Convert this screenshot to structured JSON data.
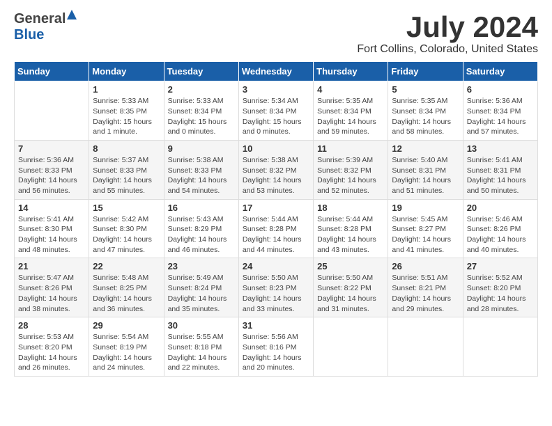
{
  "logo": {
    "general": "General",
    "blue": "Blue"
  },
  "title": {
    "month": "July 2024",
    "location": "Fort Collins, Colorado, United States"
  },
  "days_of_week": [
    "Sunday",
    "Monday",
    "Tuesday",
    "Wednesday",
    "Thursday",
    "Friday",
    "Saturday"
  ],
  "weeks": [
    [
      {
        "num": "",
        "info": ""
      },
      {
        "num": "1",
        "info": "Sunrise: 5:33 AM\nSunset: 8:35 PM\nDaylight: 15 hours\nand 1 minute."
      },
      {
        "num": "2",
        "info": "Sunrise: 5:33 AM\nSunset: 8:34 PM\nDaylight: 15 hours\nand 0 minutes."
      },
      {
        "num": "3",
        "info": "Sunrise: 5:34 AM\nSunset: 8:34 PM\nDaylight: 15 hours\nand 0 minutes."
      },
      {
        "num": "4",
        "info": "Sunrise: 5:35 AM\nSunset: 8:34 PM\nDaylight: 14 hours\nand 59 minutes."
      },
      {
        "num": "5",
        "info": "Sunrise: 5:35 AM\nSunset: 8:34 PM\nDaylight: 14 hours\nand 58 minutes."
      },
      {
        "num": "6",
        "info": "Sunrise: 5:36 AM\nSunset: 8:34 PM\nDaylight: 14 hours\nand 57 minutes."
      }
    ],
    [
      {
        "num": "7",
        "info": "Sunrise: 5:36 AM\nSunset: 8:33 PM\nDaylight: 14 hours\nand 56 minutes."
      },
      {
        "num": "8",
        "info": "Sunrise: 5:37 AM\nSunset: 8:33 PM\nDaylight: 14 hours\nand 55 minutes."
      },
      {
        "num": "9",
        "info": "Sunrise: 5:38 AM\nSunset: 8:33 PM\nDaylight: 14 hours\nand 54 minutes."
      },
      {
        "num": "10",
        "info": "Sunrise: 5:38 AM\nSunset: 8:32 PM\nDaylight: 14 hours\nand 53 minutes."
      },
      {
        "num": "11",
        "info": "Sunrise: 5:39 AM\nSunset: 8:32 PM\nDaylight: 14 hours\nand 52 minutes."
      },
      {
        "num": "12",
        "info": "Sunrise: 5:40 AM\nSunset: 8:31 PM\nDaylight: 14 hours\nand 51 minutes."
      },
      {
        "num": "13",
        "info": "Sunrise: 5:41 AM\nSunset: 8:31 PM\nDaylight: 14 hours\nand 50 minutes."
      }
    ],
    [
      {
        "num": "14",
        "info": "Sunrise: 5:41 AM\nSunset: 8:30 PM\nDaylight: 14 hours\nand 48 minutes."
      },
      {
        "num": "15",
        "info": "Sunrise: 5:42 AM\nSunset: 8:30 PM\nDaylight: 14 hours\nand 47 minutes."
      },
      {
        "num": "16",
        "info": "Sunrise: 5:43 AM\nSunset: 8:29 PM\nDaylight: 14 hours\nand 46 minutes."
      },
      {
        "num": "17",
        "info": "Sunrise: 5:44 AM\nSunset: 8:28 PM\nDaylight: 14 hours\nand 44 minutes."
      },
      {
        "num": "18",
        "info": "Sunrise: 5:44 AM\nSunset: 8:28 PM\nDaylight: 14 hours\nand 43 minutes."
      },
      {
        "num": "19",
        "info": "Sunrise: 5:45 AM\nSunset: 8:27 PM\nDaylight: 14 hours\nand 41 minutes."
      },
      {
        "num": "20",
        "info": "Sunrise: 5:46 AM\nSunset: 8:26 PM\nDaylight: 14 hours\nand 40 minutes."
      }
    ],
    [
      {
        "num": "21",
        "info": "Sunrise: 5:47 AM\nSunset: 8:26 PM\nDaylight: 14 hours\nand 38 minutes."
      },
      {
        "num": "22",
        "info": "Sunrise: 5:48 AM\nSunset: 8:25 PM\nDaylight: 14 hours\nand 36 minutes."
      },
      {
        "num": "23",
        "info": "Sunrise: 5:49 AM\nSunset: 8:24 PM\nDaylight: 14 hours\nand 35 minutes."
      },
      {
        "num": "24",
        "info": "Sunrise: 5:50 AM\nSunset: 8:23 PM\nDaylight: 14 hours\nand 33 minutes."
      },
      {
        "num": "25",
        "info": "Sunrise: 5:50 AM\nSunset: 8:22 PM\nDaylight: 14 hours\nand 31 minutes."
      },
      {
        "num": "26",
        "info": "Sunrise: 5:51 AM\nSunset: 8:21 PM\nDaylight: 14 hours\nand 29 minutes."
      },
      {
        "num": "27",
        "info": "Sunrise: 5:52 AM\nSunset: 8:20 PM\nDaylight: 14 hours\nand 28 minutes."
      }
    ],
    [
      {
        "num": "28",
        "info": "Sunrise: 5:53 AM\nSunset: 8:20 PM\nDaylight: 14 hours\nand 26 minutes."
      },
      {
        "num": "29",
        "info": "Sunrise: 5:54 AM\nSunset: 8:19 PM\nDaylight: 14 hours\nand 24 minutes."
      },
      {
        "num": "30",
        "info": "Sunrise: 5:55 AM\nSunset: 8:18 PM\nDaylight: 14 hours\nand 22 minutes."
      },
      {
        "num": "31",
        "info": "Sunrise: 5:56 AM\nSunset: 8:16 PM\nDaylight: 14 hours\nand 20 minutes."
      },
      {
        "num": "",
        "info": ""
      },
      {
        "num": "",
        "info": ""
      },
      {
        "num": "",
        "info": ""
      }
    ]
  ]
}
